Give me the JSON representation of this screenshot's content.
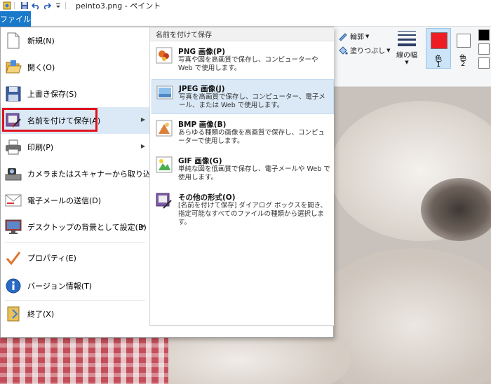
{
  "window": {
    "title": "peinto3.png - ペイント"
  },
  "tabs": {
    "file_label": "ファイル"
  },
  "ribbon": {
    "outline_label": "輪郭",
    "fill_label": "塗りつぶし",
    "size_label": "線の幅",
    "color1_label": "色",
    "color1_num": "1",
    "color2_label": "色",
    "color2_num": "2",
    "color1_hex": "#ee1c24",
    "color2_hex": "#ffffff",
    "palette_first_hex": "#000000"
  },
  "file_menu": {
    "items": [
      {
        "label": "新規(N)"
      },
      {
        "label": "開く(O)"
      },
      {
        "label": "上書き保存(S)"
      },
      {
        "label": "名前を付けて保存(A)"
      },
      {
        "label": "印刷(P)"
      },
      {
        "label": "カメラまたはスキャナーから取り込み(M)"
      },
      {
        "label": "電子メールの送信(D)"
      },
      {
        "label": "デスクトップの背景として設定(B)"
      },
      {
        "label": "プロパティ(E)"
      },
      {
        "label": "バージョン情報(T)"
      },
      {
        "label": "終了(X)"
      }
    ]
  },
  "save_as": {
    "header": "名前を付けて保存",
    "options": [
      {
        "title": "PNG 画像(P)",
        "desc": "写真や図を高画質で保存し、コンピューターや Web で使用します。"
      },
      {
        "title": "JPEG 画像(J)",
        "desc": "写真を高画質で保存し、コンピューター、電子メール、または Web で使用します。"
      },
      {
        "title": "BMP 画像(B)",
        "desc": "あらゆる種類の画像を高画質で保存し、コンピューターで使用します。"
      },
      {
        "title": "GIF 画像(G)",
        "desc": "単純な図を低画質で保存し、電子メールや Web で使用します。"
      },
      {
        "title": "その他の形式(O)",
        "desc": "[名前を付けて保存] ダイアログ ボックスを開き、指定可能なすべてのファイルの種類から選択します。"
      }
    ]
  }
}
